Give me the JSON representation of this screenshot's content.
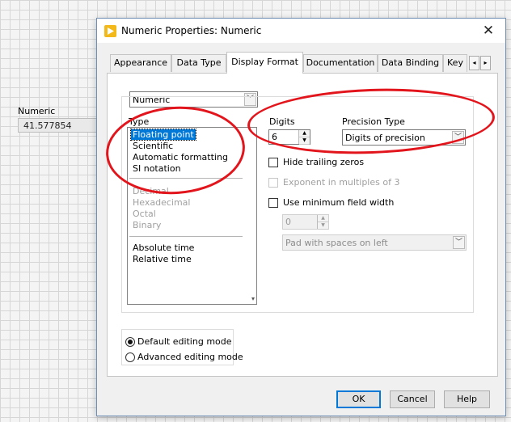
{
  "background": {
    "label": "Numeric",
    "value": "41.577854"
  },
  "dialog": {
    "title": "Numeric Properties: Numeric",
    "close_glyph": "✕",
    "tabs": [
      {
        "label": "Appearance"
      },
      {
        "label": "Data Type"
      },
      {
        "label": "Display Format",
        "active": true
      },
      {
        "label": "Documentation"
      },
      {
        "label": "Data Binding"
      },
      {
        "label": "Key"
      }
    ],
    "tab_scroll_left": "◂",
    "tab_scroll_right": "▸",
    "format_combo": {
      "value": "Numeric",
      "arrow": "﹀"
    },
    "type_label": "Type",
    "type_list": {
      "group1": [
        "Floating point",
        "Scientific",
        "Automatic formatting",
        "SI notation"
      ],
      "selected": "Floating point",
      "group2": [
        "Decimal",
        "Hexadecimal",
        "Octal",
        "Binary"
      ],
      "group3": [
        "Absolute time",
        "Relative time"
      ],
      "scroll_arrow": "▾"
    },
    "digits": {
      "label": "Digits",
      "value": "6"
    },
    "precision_type": {
      "label": "Precision Type",
      "value": "Digits of precision"
    },
    "hide_trailing_zeros": {
      "label": "Hide trailing zeros",
      "checked": false
    },
    "exponent_multiples": {
      "label": "Exponent in multiples of 3",
      "checked": false,
      "enabled": false
    },
    "use_min_field_width": {
      "label": "Use minimum field width",
      "checked": false
    },
    "min_width": {
      "value": "0",
      "enabled": false
    },
    "pad_combo": {
      "value": "Pad with spaces on left",
      "enabled": false
    },
    "editing_mode": {
      "options": [
        "Default editing mode",
        "Advanced editing mode"
      ],
      "selected": "Default editing mode"
    },
    "buttons": {
      "ok": "OK",
      "cancel": "Cancel",
      "help": "Help"
    }
  },
  "colors": {
    "selection": "#0078d7",
    "annotation": "#e3151c",
    "title_icon": "#f3b91b"
  }
}
